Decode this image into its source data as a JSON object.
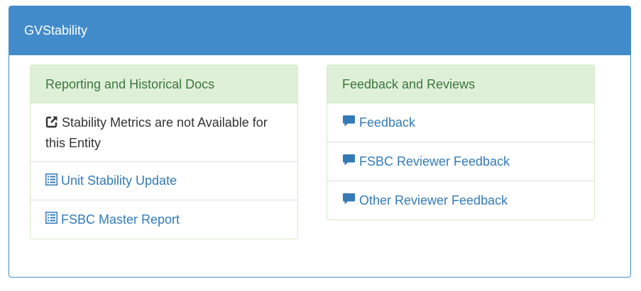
{
  "panel": {
    "title": "GVStability"
  },
  "left_panel": {
    "title": "Reporting and Historical Docs",
    "info_text": "Stability Metrics are not Available for this Entity",
    "links": [
      {
        "label": "Unit Stability Update",
        "icon": "list-alt-icon"
      },
      {
        "label": "FSBC Master Report",
        "icon": "list-alt-icon"
      }
    ]
  },
  "right_panel": {
    "title": "Feedback and Reviews",
    "links": [
      {
        "label": "Feedback",
        "icon": "comment-icon"
      },
      {
        "label": "FSBC Reviewer Feedback",
        "icon": "comment-icon"
      },
      {
        "label": "Other Reviewer Feedback",
        "icon": "comment-icon"
      }
    ]
  },
  "colors": {
    "primary": "#428bca",
    "success_bg": "#dff0d8",
    "success_text": "#3c763d",
    "link": "#337ab7"
  }
}
